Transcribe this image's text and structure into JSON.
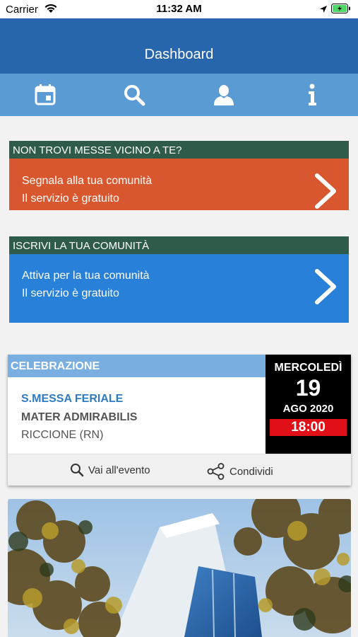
{
  "status": {
    "carrier": "Carrier",
    "time": "11:32 AM"
  },
  "header": {
    "title": "Dashboard"
  },
  "tabs": [
    {
      "icon": "calendar-icon"
    },
    {
      "icon": "search-icon"
    },
    {
      "icon": "person-icon"
    },
    {
      "icon": "info-icon"
    }
  ],
  "promo1": {
    "header": "NON TROVI MESSE VICINO A TE?",
    "line1": "Segnala alla tua comunità",
    "line2": "Il servizio è gratuito"
  },
  "promo2": {
    "header": "ISCRIVI LA TUA COMUNITÀ",
    "line1": "Attiva per la tua comunità",
    "line2": "Il servizio è gratuito"
  },
  "event": {
    "category": "CELEBRAZIONE",
    "title": "S.MESSA FERIALE",
    "church": "MATER ADMIRABILIS",
    "place": "RICCIONE (RN)",
    "weekday": "MERCOLEDÌ",
    "day": "19",
    "month_year": "AGO 2020",
    "hour": "18:00",
    "action_event": "Vai all'evento",
    "action_share": "Condividi"
  },
  "colors": {
    "header_blue": "#2766ad",
    "tab_blue": "#5a9bd4",
    "promo_header_green": "#2f5b4b",
    "promo_orange": "#d9572e",
    "promo_blue": "#2880d8",
    "category_blue": "#79aee0",
    "hour_red": "#e01019"
  }
}
